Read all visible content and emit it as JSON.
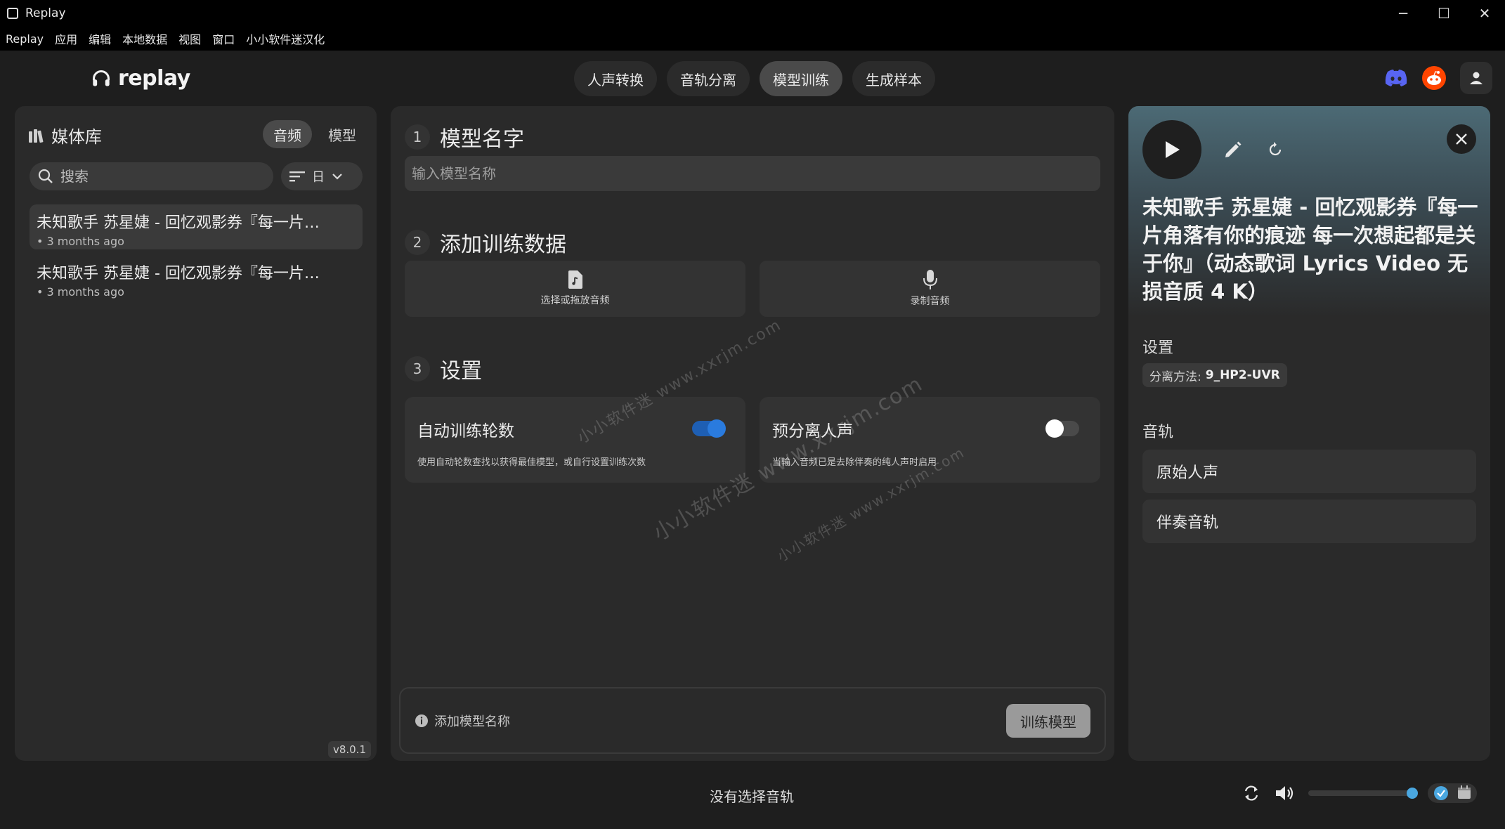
{
  "window": {
    "title": "Replay",
    "controls": [
      "minimize",
      "maximize",
      "close"
    ]
  },
  "menu": [
    "Replay",
    "应用",
    "编辑",
    "本地数据",
    "视图",
    "窗口",
    "小小软件迷汉化"
  ],
  "header": {
    "logo_text": "replay",
    "tabs": [
      {
        "label": "人声转换",
        "active": false
      },
      {
        "label": "音轨分离",
        "active": false
      },
      {
        "label": "模型训练",
        "active": true
      },
      {
        "label": "生成样本",
        "active": false
      }
    ],
    "icons": [
      "discord-icon",
      "reddit-icon",
      "account-icon"
    ]
  },
  "library": {
    "title": "媒体库",
    "tabs": [
      {
        "label": "音频",
        "active": true
      },
      {
        "label": "模型",
        "active": false
      }
    ],
    "search_placeholder": "搜索",
    "sort_label": "日",
    "items": [
      {
        "title": "未知歌手 苏星婕 - 回忆观影券『每一片角落有你的痕迹 每一次想起都是关于你』",
        "subtitle": "• 3 months ago",
        "selected": true
      },
      {
        "title": "未知歌手 苏星婕 - 回忆观影券『每一片角落有你的痕迹 每一次想起都是关于你』",
        "subtitle": "• 3 months ago",
        "selected": false
      }
    ],
    "version": "v8.0.1"
  },
  "training": {
    "step1": {
      "num": "1",
      "title": "模型名字",
      "placeholder": "输入模型名称"
    },
    "step2": {
      "num": "2",
      "title": "添加训练数据",
      "select_label": "选择或拖放音频",
      "record_label": "录制音频"
    },
    "step3": {
      "num": "3",
      "title": "设置"
    },
    "settings": [
      {
        "title": "自动训练轮数",
        "desc": "使用自动轮数查找以获得最佳模型，或自行设置训练次数",
        "enabled": true
      },
      {
        "title": "预分离人声",
        "desc": "当输入音频已是去除伴奏的纯人声时启用",
        "enabled": false
      }
    ],
    "hint": "添加模型名称",
    "train_button": "训练模型"
  },
  "detail": {
    "title": "未知歌手 苏星婕 - 回忆观影券『每一片角落有你的痕迹 每一次想起都是关于你』（动态歌词 Lyrics Video 无损音质 4 K）",
    "settings_label": "设置",
    "method_label": "分离方法:",
    "method_value": "9_HP2-UVR",
    "stems_label": "音轨",
    "stems": [
      "原始人声",
      "伴奏音轨"
    ]
  },
  "footer": {
    "status": "没有选择音轨",
    "volume": 1.0
  },
  "watermarks": [
    "小小软件迷 www.xxrjm.com",
    "小小软件迷 www.xxrjm.com",
    "小小软件迷 www.xxrjm.com"
  ],
  "colors": {
    "accent": "#2a7bde",
    "reddit": "#ff4500",
    "discord": "#5865f2"
  }
}
